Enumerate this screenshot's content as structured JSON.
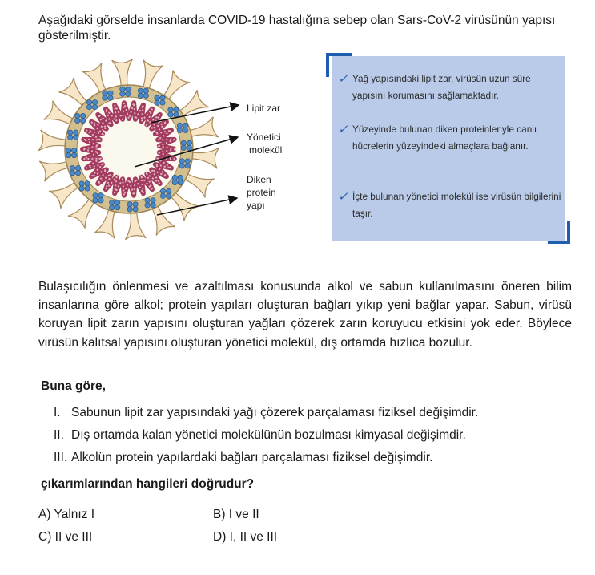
{
  "intro": "Aşağıdaki görselde insanlarda COVID-19 hastalığına sebep olan Sars-CoV-2 virüsünün yapısı gösterilmiştir.",
  "figure": {
    "labels": {
      "lipid": "Lipit zar",
      "manager_line1": "Yönetici",
      "manager_line2": "molekül",
      "spike_line1": "Diken",
      "spike_line2": "protein",
      "spike_line3": "yapı"
    },
    "colors": {
      "spike_fill": "#f7e6c8",
      "spike_stroke": "#a98a5a",
      "membrane": "#d4bf8e",
      "bead": "#4a88c8",
      "rna": "#a23b5e",
      "rna_light": "#e3b4c4"
    }
  },
  "infobox": {
    "check": "✓",
    "items": [
      "Yağ yapısındaki lipit zar, virüsün uzun süre yapısını korumasını sağlamaktadır.",
      "Yüzeyinde bulunan diken proteinleriyle canlı hücrelerin yüzeyindeki almaçlara bağlanır.",
      "İçte bulunan yönetici molekül ise virüsün bilgilerini taşır."
    ],
    "bg": "#b9cbe9",
    "accent": "#1f5eae"
  },
  "paragraph": "Bulaşıcılığın önlenmesi ve azaltılması konusunda alkol ve sabun kullanılmasını öneren bilim insanlarına göre alkol; protein yapıları oluşturan bağları yıkıp yeni bağlar yapar. Sabun, virüsü koruyan lipit zarın yapısını oluşturan yağları çözerek zarın koruyucu etkisini yok eder. Böylece virüsün kalıtsal yapısını oluşturan yönetici molekül, dış ortamda hızlıca bozulur.",
  "question": {
    "lead": "Buna göre,",
    "statements": [
      {
        "num": "I.",
        "text": "Sabunun lipit zar yapısındaki yağı çözerek parçalaması fiziksel değişimdir."
      },
      {
        "num": "II.",
        "text": "Dış ortamda kalan yönetici molekülünün bozulması kimyasal değişimdir."
      },
      {
        "num": "III.",
        "text": "Alkolün protein yapılardaki bağları parçalaması fiziksel değişimdir."
      }
    ],
    "tail": "çıkarımlarından hangileri doğrudur?"
  },
  "options": [
    "A) Yalnız I",
    "B) I ve II",
    "C) II ve III",
    "D) I, II ve III"
  ]
}
